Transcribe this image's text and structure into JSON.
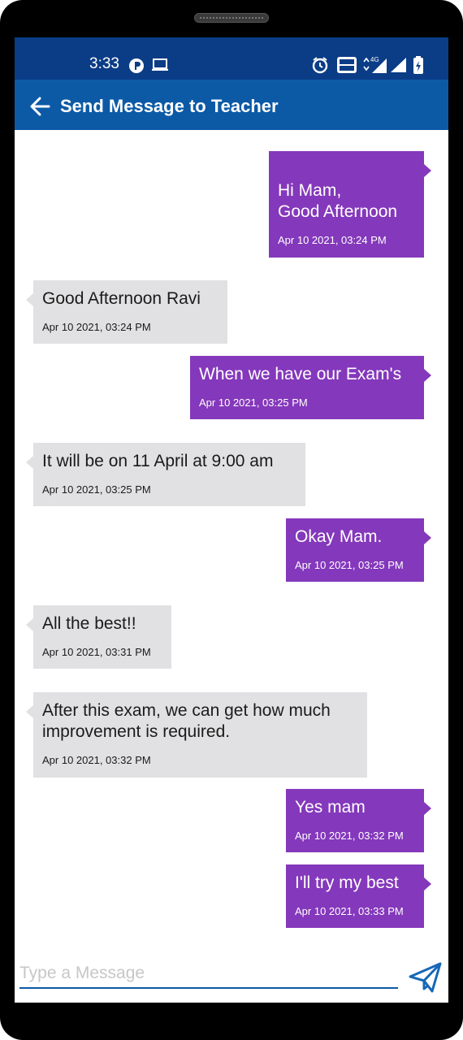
{
  "status_bar": {
    "time": "3:33"
  },
  "header": {
    "title": "Send Message to Teacher"
  },
  "messages": [
    {
      "type": "sent",
      "text": "Hi Mam,\nGood Afternoon",
      "time": "Apr 10 2021, 03:24 PM"
    },
    {
      "type": "received",
      "text": "Good Afternoon Ravi",
      "time": "Apr 10 2021, 03:24 PM"
    },
    {
      "type": "sent",
      "text": "When we have our Exam's",
      "time": "Apr 10 2021, 03:25 PM"
    },
    {
      "type": "received",
      "text": "It will be on 11 April at 9:00 am",
      "time": "Apr 10 2021, 03:25 PM"
    },
    {
      "type": "sent",
      "text": "Okay Mam.",
      "time": "Apr 10 2021, 03:25 PM"
    },
    {
      "type": "received",
      "text": "All the best!!",
      "time": "Apr 10 2021, 03:31 PM"
    },
    {
      "type": "received",
      "text": "After this exam, we can get how much\nimprovement is required.",
      "time": "Apr 10 2021, 03:32 PM"
    },
    {
      "type": "sent",
      "text": "Yes mam",
      "time": "Apr 10 2021, 03:32 PM"
    },
    {
      "type": "sent",
      "text": "I'll try my best",
      "time": "Apr 10 2021, 03:33 PM"
    }
  ],
  "composer": {
    "placeholder": "Type a Message"
  },
  "colors": {
    "status_bar": "#0b3c86",
    "app_bar": "#0c5aa6",
    "sent_bubble": "#8438bb",
    "received_bubble": "#e1e0e2"
  }
}
